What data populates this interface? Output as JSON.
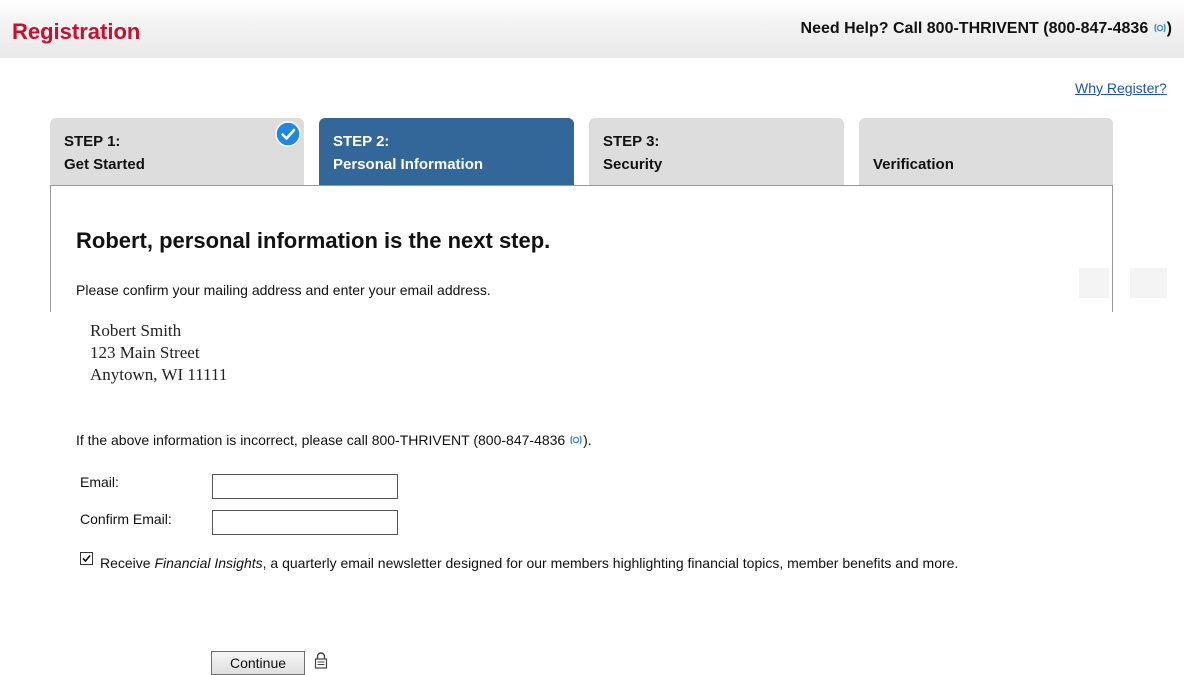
{
  "header": {
    "title": "Registration",
    "help_text": "Need Help? Call 800-THRIVENT (800-847-4836",
    "help_close": ")",
    "phone_icon": "phone-icon"
  },
  "why_register_link": "Why Register?",
  "steps": [
    {
      "line1": "STEP 1:",
      "line2": "Get Started",
      "state": "complete",
      "icon": "check-circle-icon"
    },
    {
      "line1": "STEP 2:",
      "line2": "Personal Information",
      "state": "active"
    },
    {
      "line1": "STEP 3:",
      "line2": "Security",
      "state": "inactive"
    },
    {
      "line1": "",
      "line2": "Verification",
      "state": "inactive"
    }
  ],
  "main": {
    "heading": "Robert, personal information is the next step.",
    "subtext": "Please confirm your mailing address and enter your email address.",
    "address": [
      "Robert Smith",
      "123 Main Street",
      "Anytown, WI 11111"
    ],
    "incorrect_text": "If the above information is incorrect, please call 800-THRIVENT (800-847-4836",
    "incorrect_close": ")."
  },
  "form": {
    "email_label": "Email:",
    "email_value": "",
    "confirm_label": "Confirm Email:",
    "confirm_value": "",
    "newsletter_checked": true,
    "newsletter_prefix": "Receive ",
    "newsletter_italic": "Financial Insights",
    "newsletter_rest": ", a quarterly email newsletter designed for our members highlighting financial topics, member benefits and more.",
    "continue_label": "Continue",
    "lock_icon": "lock-icon"
  },
  "colors": {
    "brand_red": "#c8102e",
    "active_tab": "#336699",
    "inactive_tab": "#dddddd",
    "link": "#1a55a8",
    "check_blue": "#1e88e5"
  }
}
